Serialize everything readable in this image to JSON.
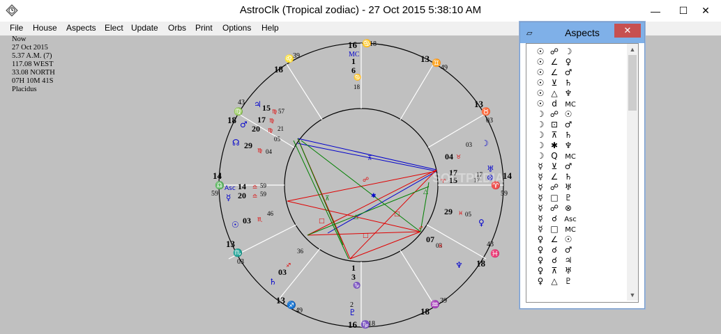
{
  "window": {
    "title": "AstroClk (Tropical zodiac) - 27 Oct 2015      5:38:10 AM",
    "minimize": "—",
    "maximize": "☐",
    "close": "✕"
  },
  "menu": {
    "items": [
      {
        "label": "File"
      },
      {
        "label": "House"
      },
      {
        "label": "Aspects"
      },
      {
        "label": "Elect"
      },
      {
        "label": "Update"
      },
      {
        "label": "Orbs"
      },
      {
        "label": "Print"
      },
      {
        "label": "Options"
      },
      {
        "label": "Help"
      }
    ]
  },
  "info": {
    "lines": [
      "Now",
      "27 Oct 2015",
      "5.37 A.M. (7)",
      "117.08 WEST",
      "33.08 NORTH",
      "07H  10M  41S",
      "Placidus"
    ]
  },
  "chart": {
    "cusp_degrees": {
      "mc_top": "16",
      "mc_label": "MC",
      "ic_bottom": "16",
      "asc_left": "14",
      "desc_right": "14",
      "c11": "13",
      "c12": "13",
      "c2": "13",
      "c3": "13",
      "c9": "18",
      "c8": "18",
      "c6": "18",
      "c5": "18"
    },
    "cusp_minutes": {
      "mc": "18",
      "ic": "18",
      "asc": "59",
      "desc": "59",
      "c11": "49",
      "c12": "03",
      "c2": "03",
      "c3": "49",
      "c9": "39",
      "c8": "43",
      "c6": "43",
      "c5": "39"
    },
    "planet_texts": [
      {
        "deg": "1",
        "min": "6",
        "label": "18"
      },
      {
        "deg": "15",
        "min": "57"
      },
      {
        "deg": "17",
        "min": "21"
      },
      {
        "deg": "20",
        "min": "05"
      },
      {
        "deg": "29",
        "min": "04"
      },
      {
        "deg": "14",
        "min": "59"
      },
      {
        "deg": "20",
        "min": "59"
      },
      {
        "deg": "03",
        "min": "46"
      },
      {
        "deg": "03",
        "min": "36"
      },
      {
        "deg": "1",
        "min": "3"
      },
      {
        "deg": "04",
        "min": "03"
      },
      {
        "deg": "17",
        "min": "17"
      },
      {
        "deg": "15",
        "min": "17"
      },
      {
        "deg": "29",
        "min": "05"
      },
      {
        "deg": "07",
        "min": "03"
      }
    ],
    "aux_labels": {
      "asc": "Asc",
      "mc": "MC",
      "ic_minute": "2"
    },
    "watermark": "SOFTPEDIA"
  },
  "aspects_window": {
    "title": "Aspects",
    "close_label": "✕",
    "rows": [
      [
        "☉",
        "☍",
        "☽"
      ],
      [
        "☉",
        "∠",
        "♀"
      ],
      [
        "☉",
        "∠",
        "♂"
      ],
      [
        "☉",
        "⊻",
        "♄"
      ],
      [
        "☉",
        "△",
        "♆"
      ],
      [
        "☉",
        "d",
        "MC"
      ],
      [
        "☽",
        "☍",
        "☉"
      ],
      [
        "☽",
        "⊡",
        "♂"
      ],
      [
        "☽",
        "⊼",
        "♄"
      ],
      [
        "☽",
        "✱",
        "♆"
      ],
      [
        "☽",
        "Q",
        "MC"
      ],
      [
        "☿",
        "⊻",
        "♂"
      ],
      [
        "☿",
        "∠",
        "♄"
      ],
      [
        "☿",
        "☍",
        "♅"
      ],
      [
        "☿",
        "□",
        "♇"
      ],
      [
        "☿",
        "☍",
        "⊗"
      ],
      [
        "☿",
        "☌",
        "Asc"
      ],
      [
        "☿",
        "□",
        "MC"
      ],
      [
        "♀",
        "∠",
        "☉"
      ],
      [
        "♀",
        "☌",
        "♂"
      ],
      [
        "♀",
        "☌",
        "♃"
      ],
      [
        "♀",
        "⊼",
        "♅"
      ],
      [
        "♀",
        "△",
        "♇"
      ]
    ],
    "scroll_up": "▲",
    "scroll_down": "▼"
  },
  "colors": {
    "accent_red": "#e00000",
    "accent_blue": "#0000cc",
    "accent_green": "#008000",
    "title_bar_active": "#7fb0e8",
    "close_red": "#c75050"
  }
}
